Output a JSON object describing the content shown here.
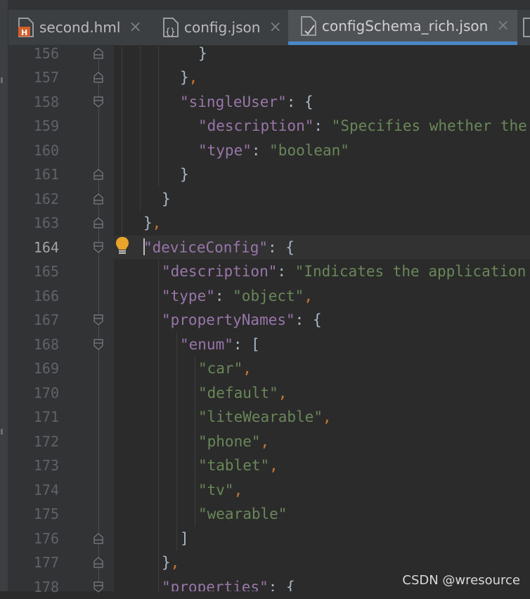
{
  "tabs": [
    {
      "label": "second.hml",
      "icon": "hml-file-icon",
      "active": false
    },
    {
      "label": "config.json",
      "icon": "json-file-icon",
      "active": false
    },
    {
      "label": "configSchema_rich.json",
      "icon": "json-schema-file-icon",
      "active": true
    }
  ],
  "editor": {
    "current_line": "164",
    "lines": [
      {
        "n": "156",
        "fold": "end"
      },
      {
        "n": "157",
        "fold": "end"
      },
      {
        "n": "158",
        "fold": "start"
      },
      {
        "n": "159",
        "fold": ""
      },
      {
        "n": "160",
        "fold": ""
      },
      {
        "n": "161",
        "fold": "end"
      },
      {
        "n": "162",
        "fold": "end"
      },
      {
        "n": "163",
        "fold": "end"
      },
      {
        "n": "164",
        "fold": "start"
      },
      {
        "n": "165",
        "fold": ""
      },
      {
        "n": "166",
        "fold": ""
      },
      {
        "n": "167",
        "fold": "start"
      },
      {
        "n": "168",
        "fold": "start"
      },
      {
        "n": "169",
        "fold": ""
      },
      {
        "n": "170",
        "fold": ""
      },
      {
        "n": "171",
        "fold": ""
      },
      {
        "n": "172",
        "fold": ""
      },
      {
        "n": "173",
        "fold": ""
      },
      {
        "n": "174",
        "fold": ""
      },
      {
        "n": "175",
        "fold": ""
      },
      {
        "n": "176",
        "fold": "end"
      },
      {
        "n": "177",
        "fold": "end"
      },
      {
        "n": "178",
        "fold": "start"
      }
    ],
    "code": {
      "l156_brace": "}",
      "l157_brace": "}",
      "l157_comma": ",",
      "l158_key": "\"singleUser\"",
      "l158_rest": ": {",
      "l159_key": "\"description\"",
      "l159_colon": ": ",
      "l159_value": "\"Specifies whether the",
      "l160_key": "\"type\"",
      "l160_colon": ": ",
      "l160_value": "\"boolean\"",
      "l161_brace": "}",
      "l162_brace": "}",
      "l163_brace": "}",
      "l163_comma": ",",
      "l164_key": "\"deviceConfig\"",
      "l164_rest": ": {",
      "l165_key": "\"description\"",
      "l165_colon": ": ",
      "l165_value": "\"Indicates the application",
      "l166_key": "\"type\"",
      "l166_colon": ": ",
      "l166_value": "\"object\"",
      "l166_comma": ",",
      "l167_key": "\"propertyNames\"",
      "l167_rest": ": {",
      "l168_key": "\"enum\"",
      "l168_rest": ": [",
      "l169_value": "\"car\"",
      "l169_comma": ",",
      "l170_value": "\"default\"",
      "l170_comma": ",",
      "l171_value": "\"liteWearable\"",
      "l171_comma": ",",
      "l172_value": "\"phone\"",
      "l172_comma": ",",
      "l173_value": "\"tablet\"",
      "l173_comma": ",",
      "l174_value": "\"tv\"",
      "l174_comma": ",",
      "l175_value": "\"wearable\"",
      "l176_bracket": "]",
      "l177_brace": "}",
      "l177_comma": ",",
      "l178_key": "\"properties\"",
      "l178_rest": ": {"
    },
    "intention_icon": "lightbulb-icon"
  },
  "watermark": "CSDN @wresource",
  "colors": {
    "background": "#2b2b2b",
    "gutter": "#313335",
    "key": "#9876aa",
    "string": "#6a8759",
    "punctuation": "#a9b7c6",
    "comma": "#cc7832",
    "active_tab_underline": "#4a88c7",
    "bulb": "#e8a52b"
  }
}
